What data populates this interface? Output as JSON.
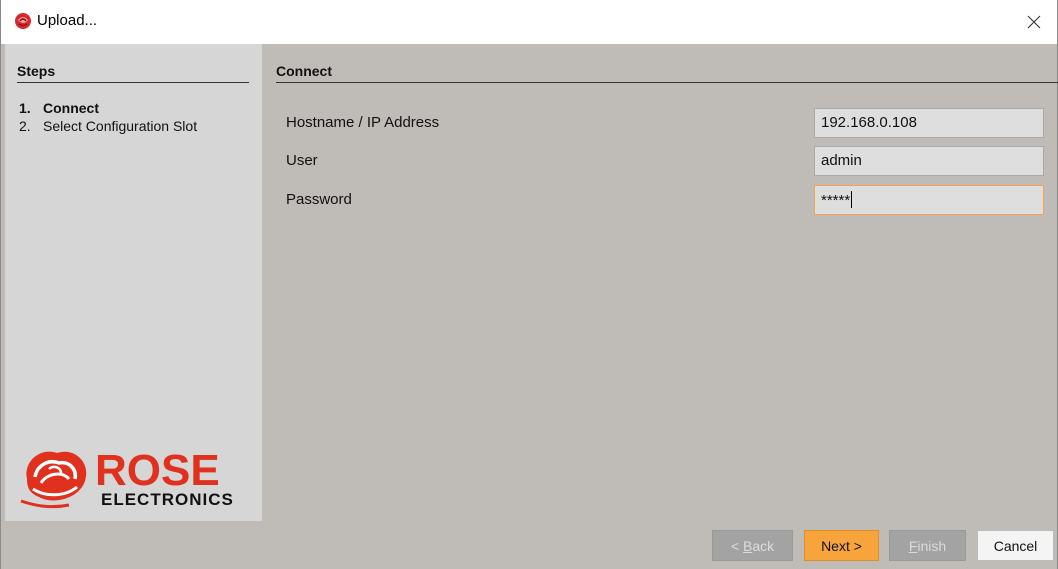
{
  "window": {
    "title": "Upload...",
    "app_icon": "rose-icon",
    "close_icon": "close-icon"
  },
  "steps": {
    "header": "Steps",
    "items": [
      {
        "num": "1.",
        "label": "Connect",
        "active": true
      },
      {
        "num": "2.",
        "label": "Select Configuration Slot",
        "active": false
      }
    ]
  },
  "logo": {
    "brand": "ROSE",
    "subtitle": "ELECTRONICS"
  },
  "connect": {
    "header": "Connect",
    "fields": [
      {
        "label": "Hostname / IP Address",
        "value": "192.168.0.108"
      },
      {
        "label": "User",
        "value": "admin"
      },
      {
        "label": "Password",
        "value": "*****"
      }
    ]
  },
  "buttons": {
    "back": {
      "prefix": "< ",
      "mnemonic": "B",
      "rest": "ack",
      "enabled": false
    },
    "next": {
      "label": "Next >",
      "enabled": true
    },
    "finish": {
      "mnemonic": "F",
      "rest": "inish",
      "enabled": false
    },
    "cancel": {
      "label": "Cancel",
      "enabled": true
    }
  },
  "colors": {
    "accent": "#f7a43c",
    "panel_bg": "#bfbbb7",
    "steps_bg": "#d6d6d6",
    "logo_red": "#e0301e"
  }
}
